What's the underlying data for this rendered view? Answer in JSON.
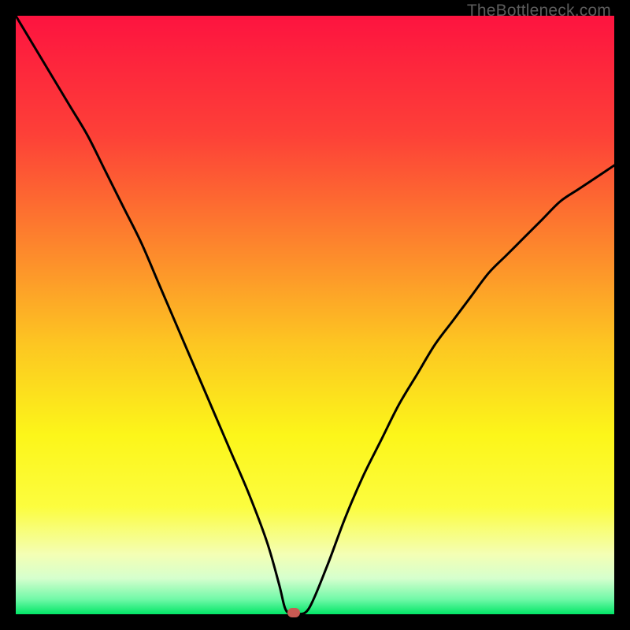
{
  "watermark": "TheBottleneck.com",
  "marker": {
    "color": "#c95a53"
  },
  "chart_data": {
    "type": "line",
    "title": "",
    "xlabel": "",
    "ylabel": "",
    "xlim": [
      0,
      100
    ],
    "ylim": [
      0,
      100
    ],
    "x": [
      0,
      3,
      6,
      9,
      12,
      15,
      18,
      21,
      24,
      27,
      30,
      33,
      36,
      39,
      42,
      44,
      45,
      46,
      47,
      49,
      52,
      55,
      58,
      61,
      64,
      67,
      70,
      73,
      76,
      79,
      82,
      85,
      88,
      91,
      94,
      97,
      100
    ],
    "values": [
      100,
      95,
      90,
      85,
      80,
      74,
      68,
      62,
      55,
      48,
      41,
      34,
      27,
      20,
      12,
      5,
      1,
      0,
      0,
      1,
      8,
      16,
      23,
      29,
      35,
      40,
      45,
      49,
      53,
      57,
      60,
      63,
      66,
      69,
      71,
      73,
      75
    ],
    "marker_point": {
      "x": 46.5,
      "y": 0
    },
    "gradient_stops": [
      {
        "pos": 0.0,
        "color": "#fd1440"
      },
      {
        "pos": 0.2,
        "color": "#fd4138"
      },
      {
        "pos": 0.4,
        "color": "#fd8c2c"
      },
      {
        "pos": 0.55,
        "color": "#fdc722"
      },
      {
        "pos": 0.7,
        "color": "#fcf61a"
      },
      {
        "pos": 0.82,
        "color": "#fcfd3f"
      },
      {
        "pos": 0.9,
        "color": "#f4ffb5"
      },
      {
        "pos": 0.94,
        "color": "#d6ffce"
      },
      {
        "pos": 0.975,
        "color": "#71f9a8"
      },
      {
        "pos": 1.0,
        "color": "#02e667"
      }
    ]
  }
}
